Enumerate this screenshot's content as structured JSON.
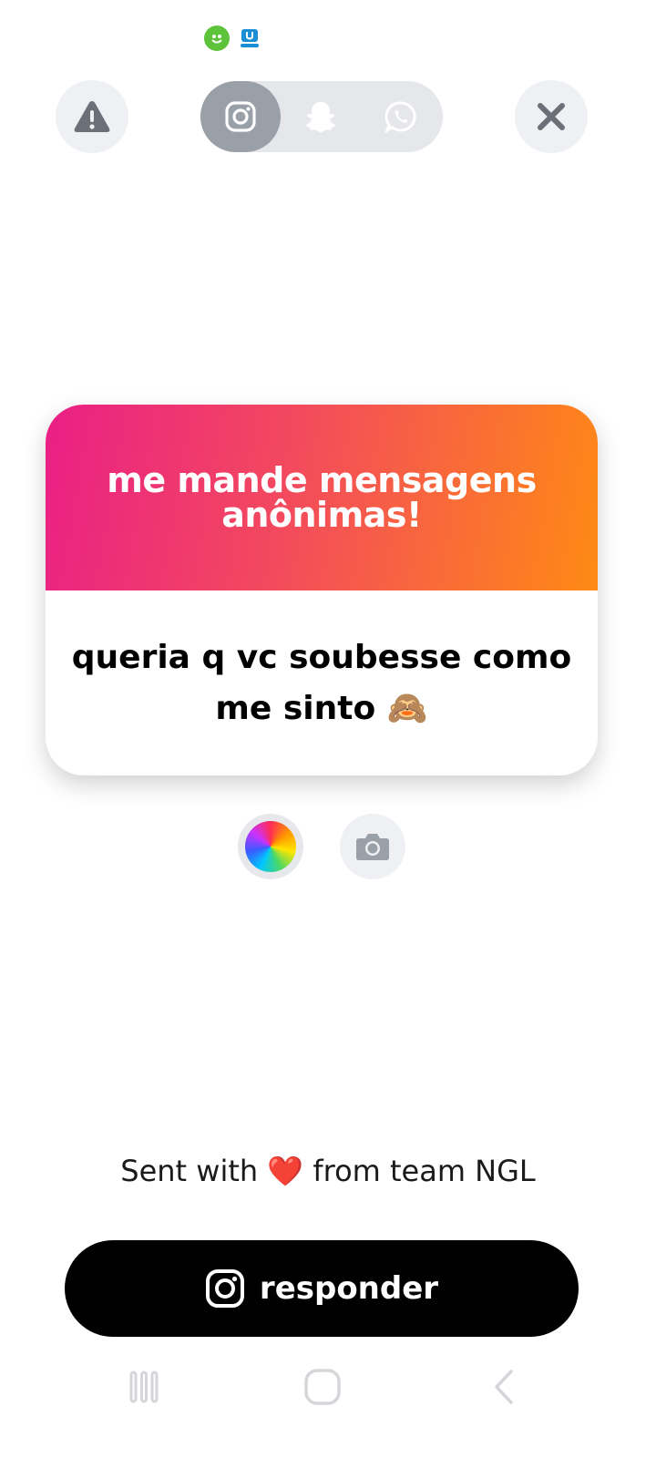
{
  "status_bar": {
    "icons": [
      "hapmod-app-icon",
      "upload-app-icon"
    ]
  },
  "top_bar": {
    "report_icon": "warning-icon",
    "close_icon": "close-icon",
    "share_targets": [
      {
        "name": "instagram-icon",
        "active": true
      },
      {
        "name": "snapchat-icon",
        "active": false
      },
      {
        "name": "whatsapp-icon",
        "active": false
      }
    ]
  },
  "card": {
    "prompt": "me mande mensagens anônimas!",
    "message": "queria q vc soubesse como me sinto 🙈",
    "gradient": [
      "#ea1f86",
      "#f34b5c",
      "#ff8a14"
    ]
  },
  "tools": {
    "color_icon": "color-wheel-icon",
    "camera_icon": "camera-icon"
  },
  "footer": {
    "prefix": "Sent with",
    "heart": "❤️",
    "suffix": "from team NGL"
  },
  "reply_button": {
    "label": "responder",
    "icon": "instagram-icon"
  },
  "nav_bar": {
    "items": [
      "recents-icon",
      "home-icon",
      "back-icon"
    ]
  },
  "colors": {
    "button_bg": "#eef0f3",
    "icon_gray": "#6b7078",
    "active_segment": "#9aa0a8",
    "reply_bg": "#000000"
  }
}
